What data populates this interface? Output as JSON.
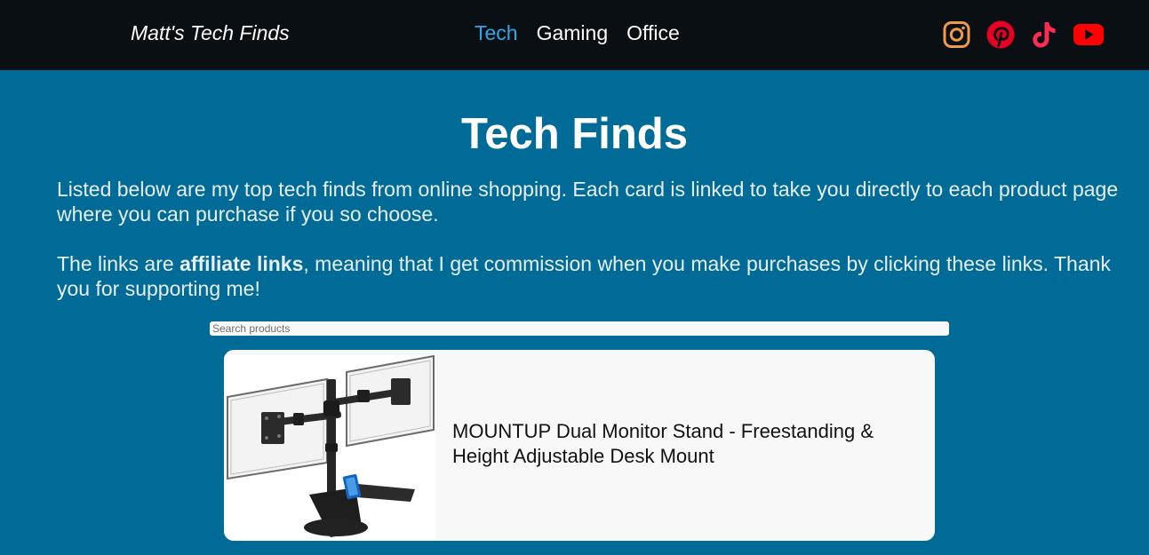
{
  "header": {
    "brand": "Matt's Tech Finds",
    "nav": [
      {
        "label": "Tech",
        "active": true
      },
      {
        "label": "Gaming",
        "active": false
      },
      {
        "label": "Office",
        "active": false
      }
    ],
    "social_icons": [
      "instagram-icon",
      "pinterest-icon",
      "tiktok-icon",
      "youtube-icon"
    ]
  },
  "main": {
    "title": "Tech Finds",
    "intro_1": "Listed below are my top tech finds from online shopping. Each card is linked to take you directly to each product page where you can purchase if you so choose.",
    "intro_2_before": "The links are ",
    "intro_2_bold": "affiliate links",
    "intro_2_after": ", meaning that I get commission when you make purchases by clicking these links. Thank you for supporting me!",
    "search_placeholder": "Search products",
    "products": [
      {
        "title": "MOUNTUP Dual Monitor Stand - Freestanding & Height Adjustable Desk Mount"
      }
    ]
  },
  "colors": {
    "navbar_bg": "#0a0f13",
    "page_bg": "#006b96",
    "nav_active": "#2fa7e6",
    "card_bg": "#f8f8f8",
    "instagram": "#f09a4a",
    "pinterest": "#e60023",
    "tiktok": "#fe2c55",
    "youtube": "#ff0000"
  }
}
